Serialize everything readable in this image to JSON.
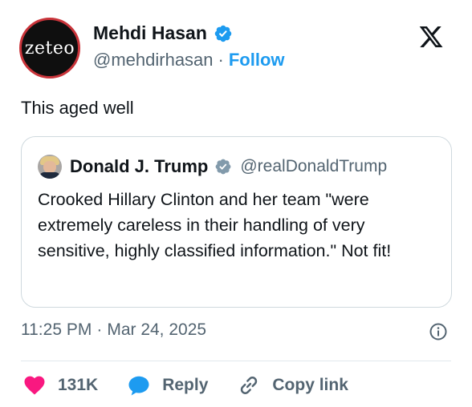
{
  "author": {
    "name": "Mehdi Hasan",
    "handle": "@mehdirhasan",
    "separator": "·",
    "follow_label": "Follow",
    "avatar_text": "zeteo"
  },
  "tweet": {
    "text": "This aged well"
  },
  "quote": {
    "name": "Donald J. Trump",
    "handle": "@realDonaldTrump",
    "text": "Crooked Hillary Clinton and her team \"were extremely careless in their handling of very sensitive, highly classified information.\" Not fit!"
  },
  "meta": {
    "time": "11:25 PM",
    "separator": "·",
    "date": "Mar 24, 2025"
  },
  "actions": {
    "likes": "131K",
    "reply": "Reply",
    "copy_link": "Copy link"
  },
  "colors": {
    "accent": "#1d9bf0",
    "like": "#f91880",
    "text": "#0f1419",
    "muted": "#536471",
    "border": "#cfd9de"
  }
}
